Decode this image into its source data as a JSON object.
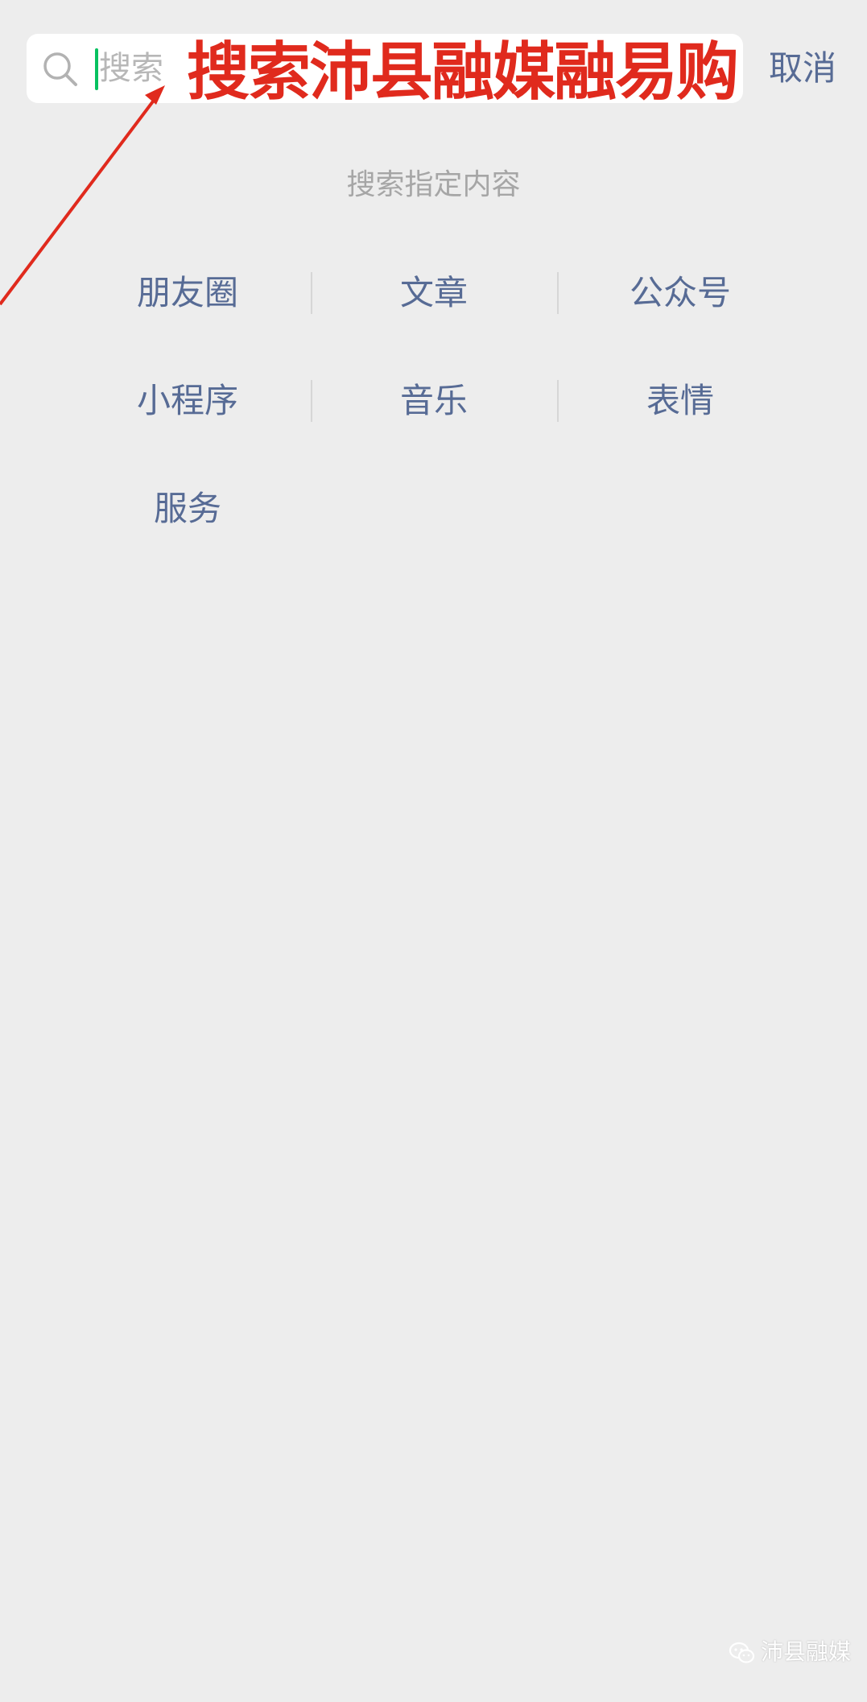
{
  "search": {
    "placeholder": "搜索",
    "cancel_label": "取消"
  },
  "annotation": {
    "text": "搜索沛县融媒融易购",
    "color": "#e02a1d"
  },
  "hint": "搜索指定内容",
  "categories": [
    {
      "label": "朋友圈"
    },
    {
      "label": "文章"
    },
    {
      "label": "公众号"
    },
    {
      "label": "小程序"
    },
    {
      "label": "音乐"
    },
    {
      "label": "表情"
    },
    {
      "label": "服务"
    }
  ],
  "watermark": {
    "text": "沛县融媒",
    "icon": "wechat-icon"
  },
  "colors": {
    "link": "#576b95",
    "caret": "#07c160",
    "background": "#ededed"
  }
}
